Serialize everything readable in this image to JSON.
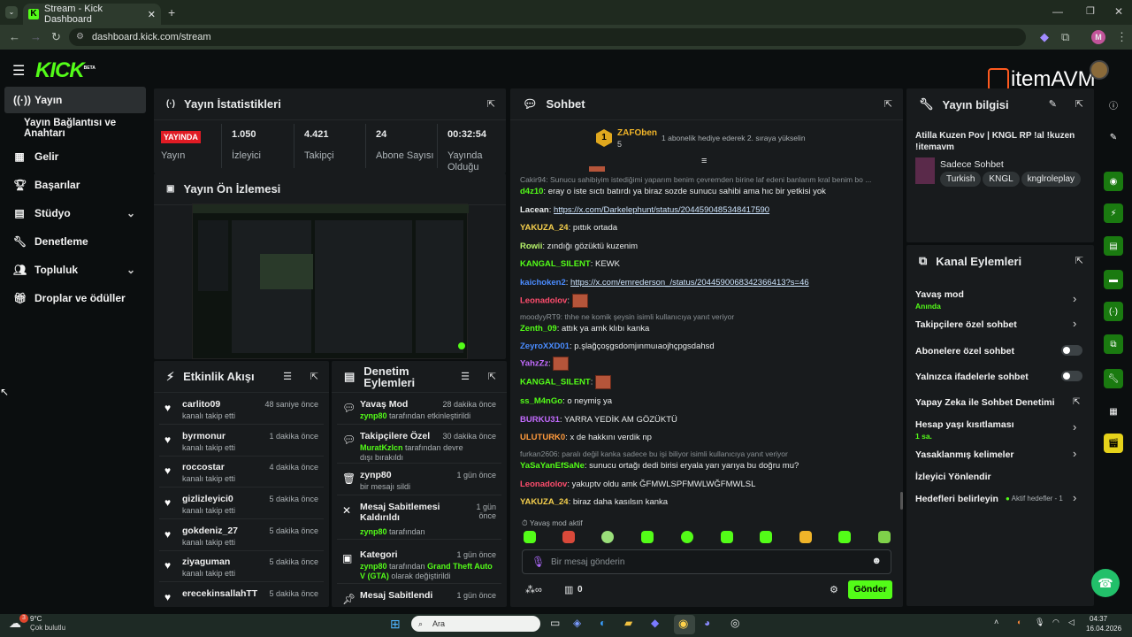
{
  "browser": {
    "tab_title": "Stream - Kick Dashboard",
    "url": "dashboard.kick.com/stream",
    "profile": "M"
  },
  "app": {
    "logo": "KICK",
    "logo_badge": "BETA",
    "watermark": "itemAVM"
  },
  "sidebar": {
    "items": [
      {
        "label": "Yayın",
        "icon": "broadcast-icon"
      },
      {
        "label": "Yayın Bağlantısı ve Anahtarı",
        "icon": ""
      },
      {
        "label": "Gelir",
        "icon": "chart-icon"
      },
      {
        "label": "Başarılar",
        "icon": "trophy-icon"
      },
      {
        "label": "Stüdyo",
        "icon": "studio-icon"
      },
      {
        "label": "Denetleme",
        "icon": "wrench-icon"
      },
      {
        "label": "Topluluk",
        "icon": "users-icon"
      },
      {
        "label": "Droplar ve ödüller",
        "icon": "gift-icon"
      }
    ]
  },
  "stats": {
    "title": "Yayın İstatistikleri",
    "live_badge": "YAYINDA",
    "live_label": "Yayın",
    "viewers": "1.050",
    "viewers_label": "İzleyici",
    "followers": "4.421",
    "followers_label": "Takipçi",
    "subs": "24",
    "subs_label": "Abone Sayısı",
    "uptime": "00:32:54",
    "uptime_label": "Yayında Olduğu Süre"
  },
  "preview": {
    "title": "Yayın Ön İzlemesi"
  },
  "activity": {
    "title": "Etkinlik Akışı",
    "items": [
      {
        "user": "carlito09",
        "action": "kanalı takip etti",
        "time": "48 saniye önce"
      },
      {
        "user": "byrmonur",
        "action": "kanalı takip etti",
        "time": "1 dakika önce"
      },
      {
        "user": "roccostar",
        "action": "kanalı takip etti",
        "time": "4 dakika önce"
      },
      {
        "user": "gizlizleyici0",
        "action": "kanalı takip etti",
        "time": "5 dakika önce"
      },
      {
        "user": "gokdeniz_27",
        "action": "kanalı takip etti",
        "time": "5 dakika önce"
      },
      {
        "user": "ziyaguman",
        "action": "kanalı takip etti",
        "time": "5 dakika önce"
      },
      {
        "user": "erecekinsallahTT",
        "action": "",
        "time": "5 dakika önce"
      }
    ]
  },
  "modactions": {
    "title": "Denetim Eylemleri",
    "items": [
      {
        "title": "Yavaş Mod",
        "actor": "zynp80",
        "detail": "tarafından etkinleştirildi",
        "time": "28 dakika önce"
      },
      {
        "title": "Takipçilere Özel",
        "actor": "MuratKzlcn",
        "detail": "tarafından devre dışı bırakıldı",
        "time": "30 dakika önce"
      },
      {
        "title": "zynp80",
        "actor": "",
        "detail": "bir mesajı sildi",
        "time": "1 gün önce"
      },
      {
        "title": "Mesaj Sabitlemesi Kaldırıldı",
        "actor": "zynp80",
        "detail": "tarafından",
        "time": "1 gün önce"
      },
      {
        "title": "Kategori",
        "actor": "zynp80",
        "detail": "tarafından",
        "extra": "Grand Theft Auto V (GTA)",
        "extra2": "olarak değiştirildi",
        "time": "1 gün önce"
      },
      {
        "title": "Mesaj Sabitlendi",
        "actor": "",
        "detail": "",
        "time": "1 gün önce"
      }
    ]
  },
  "chat": {
    "title": "Sohbet",
    "top_user": "ZAFOben",
    "top_count": "5",
    "top_msg": "1 abonelik hediye ederek 2. sıraya yükselin",
    "slow_mode": "Yavaş mod aktif",
    "placeholder": "Bir mesaj gönderin",
    "send": "Gönder",
    "points": "0",
    "messages": [
      {
        "reply": "Cakir94: Sunucu sahibiyim istediğimi yaparım benim çevremden birine laf edeni banlarım kral benim bo ...",
        "user": "d4z10",
        "color": "#53fc18",
        "text": "eray o iste sıctı batırdı ya biraz sozde sunucu sahibi ama hıc bir yetkisi yok"
      },
      {
        "user": "Lacean",
        "color": "#e9ecec",
        "link": "https://x.com/Darkelephunt/status/2044590485348417590"
      },
      {
        "user": "YAKUZA_24",
        "color": "#f6d04d",
        "text": "pıttık ortada"
      },
      {
        "user": "Rowii",
        "color": "#b7f36a",
        "text": "zındığı gözüktü kuzenim"
      },
      {
        "user": "KANGAL_SILENT",
        "color": "#53fc18",
        "text": "KEWK"
      },
      {
        "user": "kaichoken2",
        "color": "#4a8cff",
        "link": "https://x.com/emrederson_/status/2044590068342366413?s=46"
      },
      {
        "user": "Leonadolov",
        "color": "#ff4d6d",
        "emote": true
      },
      {
        "reply": "moodyyRT9: thhe ne komik şeysin isimli kullanıcıya yanıt veriyor",
        "user": "Zenth_09",
        "color": "#53fc18",
        "text": "attık ya amk klıbı kanka"
      },
      {
        "user": "ZeyroXXD01",
        "color": "#4a8cff",
        "text": "p.şlağçoşgsdomjınmuıaojhçpgsdahsd"
      },
      {
        "user": "YahzZz",
        "color": "#c36bff",
        "emote": true
      },
      {
        "user": "KANGAL_SILENT",
        "color": "#53fc18",
        "emote": true
      },
      {
        "user": "ss_M4nGo",
        "color": "#53fc18",
        "text": "o neymiş ya"
      },
      {
        "user": "BURKU31",
        "color": "#c36bff",
        "text": "YARRA YEDİK AM GÖZÜKTÜ"
      },
      {
        "user": "ULUTURK0",
        "color": "#ff9a3c",
        "text": "x de hakkını verdik np"
      },
      {
        "reply": "furkan2606: paralı değil kanka sadece bu işi biliyor isimli kullanıcıya yanıt veriyor",
        "user": "YaSaYanEfSaNe",
        "color": "#53fc18",
        "text": "sunucu ortağı dedi birisi eryala yarı yarıya bu doğru mu?"
      },
      {
        "user": "Leonadolov",
        "color": "#ff4d6d",
        "text": "yakuptv oldu amk ĞFMWLSPFMWLWĞFMWLSL"
      },
      {
        "user": "YAKUZA_24",
        "color": "#f6d04d",
        "text": "biraz daha kasılsın kanka"
      }
    ]
  },
  "info": {
    "title": "Yayın bilgisi",
    "stream_title": "Atilla Kuzen Pov | KNGL RP !al !kuzen !itemavm",
    "category": "Sadece Sohbet",
    "tags": [
      "Turkish",
      "KNGL",
      "knglroleplay"
    ]
  },
  "channel": {
    "title": "Kanal Eylemleri",
    "slow": "Yavaş mod",
    "slow_sub": "Anında",
    "followers_only": "Takipçilere özel sohbet",
    "subs_only": "Abonelere özel sohbet",
    "emotes_only": "Yalnızca ifadelerle sohbet",
    "ai_mod": "Yapay Zeka ile Sohbet Denetimi",
    "age": "Hesap yaşı kısıtlaması",
    "age_sub": "1 sa.",
    "banned": "Yasaklanmış kelimeler",
    "redirect": "İzleyici Yönlendir",
    "goals": "Hedefleri belirleyin",
    "goals_sub": "Aktif hedefler - 1"
  },
  "taskbar": {
    "weather": "9°C",
    "weather_desc": "Çok bulutlu",
    "search": "Ara",
    "time": "04:37",
    "date": "16.04.2026",
    "badge": "3"
  }
}
